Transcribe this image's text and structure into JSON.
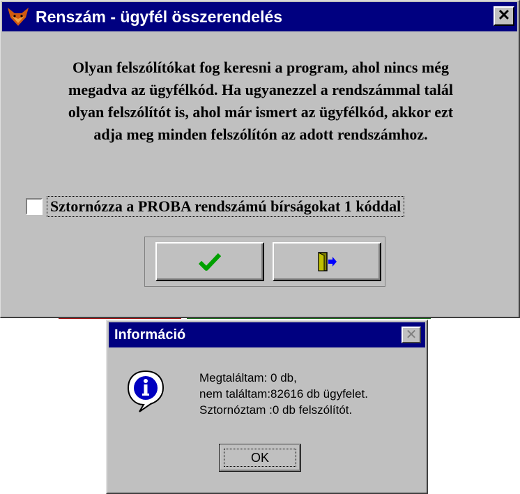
{
  "main_dialog": {
    "title": "Renszám - ügyfél összerendelés",
    "close_glyph": "✕",
    "message_lines": [
      "Olyan felszólítókat fog keresni a program, ahol nincs még",
      "megadva az ügyfélkód. Ha ugyanezzel a rendszámmal talál",
      "olyan felszólítót is, ahol már ismert az ügyfélkód, akkor ezt",
      "adja meg minden felszólítón az adott rendszámhoz."
    ],
    "checkbox": {
      "label": "Sztornózza a PROBA rendszámú bírságokat   1 kóddal",
      "checked": false
    },
    "ok_icon": "checkmark-icon",
    "exit_icon": "exit-door-icon",
    "ok_icon_color": "#00a000",
    "exit_icon_colors": [
      "#808000",
      "#0000ff"
    ]
  },
  "info_dialog": {
    "title": "Információ",
    "close_glyph": "✕",
    "icon": "info-icon",
    "lines": [
      "Megtaláltam: 0 db,",
      "nem találtam:82616 db ügyfelet.",
      "Sztornóztam :0 db felszólítót."
    ],
    "ok_label": "OK"
  },
  "colors": {
    "titlebar": "#000080",
    "face": "#c0c0c0"
  }
}
